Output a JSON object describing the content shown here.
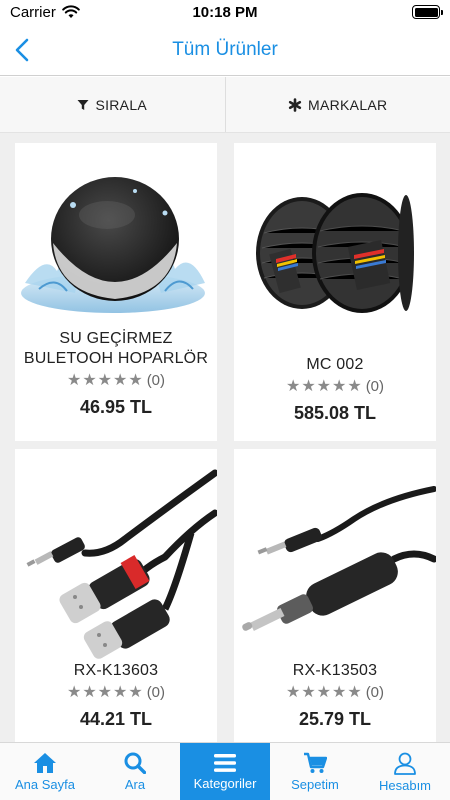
{
  "status_bar": {
    "carrier": "Carrier",
    "time": "10:18 PM"
  },
  "nav": {
    "title": "Tüm Ürünler"
  },
  "filters": {
    "sort_label": "SIRALA",
    "brands_label": "MARKALAR"
  },
  "products": [
    {
      "name": "SU GEÇİRMEZ BULETOOH HOPARLÖR",
      "rating_count": "(0)",
      "price": "46.95 TL",
      "image": "speaker"
    },
    {
      "name": "MC 002",
      "rating_count": "(0)",
      "price": "585.08 TL",
      "image": "cable-reel"
    },
    {
      "name": "RX-K13603",
      "rating_count": "(0)",
      "price": "44.21 TL",
      "image": "xlr-y-cable"
    },
    {
      "name": "RX-K13503",
      "rating_count": "(0)",
      "price": "25.79 TL",
      "image": "jack-cable"
    }
  ],
  "tabs": [
    {
      "label": "Ana Sayfa",
      "icon": "home-icon",
      "active": false
    },
    {
      "label": "Ara",
      "icon": "search-icon",
      "active": false
    },
    {
      "label": "Kategoriler",
      "icon": "menu-icon",
      "active": true
    },
    {
      "label": "Sepetim",
      "icon": "cart-icon",
      "active": false
    },
    {
      "label": "Hesabım",
      "icon": "user-icon",
      "active": false
    }
  ],
  "colors": {
    "accent": "#1a8fe3",
    "star": "#8a8a8a",
    "grid_bg": "#efefef"
  }
}
